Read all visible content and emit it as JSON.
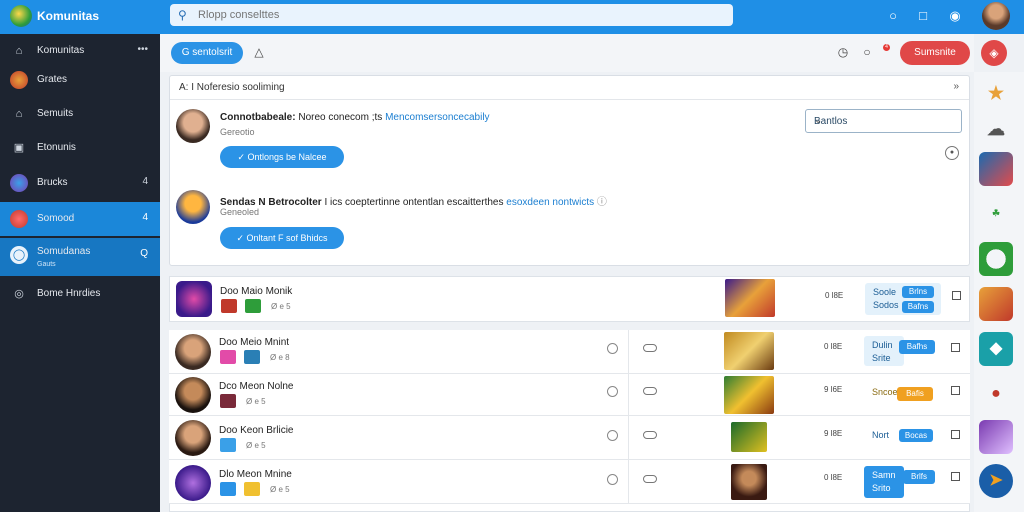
{
  "app": {
    "title": "Komunitas"
  },
  "search": {
    "placeholder": "Rlopp conselttes"
  },
  "sidebar": {
    "items": [
      {
        "label": "Komunitas",
        "badge": "•••",
        "icon": "home-icon"
      },
      {
        "label": "Grates",
        "icon": "globe-icon"
      },
      {
        "label": "Semuits",
        "icon": "home-outline-icon"
      },
      {
        "label": "Etonunis",
        "icon": "document-icon"
      },
      {
        "label": "Brucks",
        "badge": "4",
        "icon": "puzzle-icon"
      },
      {
        "label": "Somood",
        "badge": "4",
        "icon": "game-icon"
      },
      {
        "label": "Somudanas",
        "sub": "Gauts",
        "badge": "Q",
        "icon": "world-icon"
      },
      {
        "label": "Bome Hnrdies",
        "icon": "gamepad-icon"
      }
    ]
  },
  "toolbar": {
    "pill_label": "G sentolsrit",
    "action_label": "Sumsnite",
    "notif_count": "4"
  },
  "requests_panel": {
    "title": "A: I Noferesio sooliming",
    "select_value": "Bantlos",
    "items": [
      {
        "name": "Connotbabeale:",
        "text": "Noreo conecom ;ts",
        "link": "Mencomsersoncecabily",
        "sub": "Gereotio",
        "button": "Ontlongs be Nalcee"
      },
      {
        "name": "Sendas N Betrocolter",
        "text": "I ics coeptertinne ontentlan escaitterthes",
        "link": "esoxdeen nontwicts",
        "sub": "Geneoled",
        "button": "Onltant F sof Bhidcs"
      }
    ]
  },
  "rows": [
    {
      "title": "Doo Maio Monik",
      "stats": "Ø e 5",
      "score": "0 l8E",
      "tag1": "Soole",
      "tag2": "Sodos",
      "badge1": "Brlns",
      "badge2": "Bafns"
    },
    {
      "title": "Doo Meio Mnint",
      "stats": "Ø e 8",
      "score": "0 l8E",
      "tag1": "Dulin",
      "tag2": "Srite",
      "badge1": "Bafhs"
    },
    {
      "title": "Dco Meon Nolne",
      "stats": "Ø e 5",
      "score": "9 l6E",
      "tag1": "Sncoe",
      "badge1": "Bafis"
    },
    {
      "title": "Doo Keon Brlicie",
      "stats": "Ø e 5",
      "score": "9 l8E",
      "tag1": "Nort",
      "badge1": "Bocas"
    },
    {
      "title": "Dlo Meon Mnine",
      "stats": "Ø e 5",
      "score": "0 l8E",
      "tag1": "Samn",
      "tag2": "Srito",
      "badge1": "Brlfs"
    }
  ],
  "colors": {
    "primary": "#1f8fe6",
    "sidebar": "#1d2430",
    "danger": "#e04848",
    "accent": "#2b93e6"
  }
}
